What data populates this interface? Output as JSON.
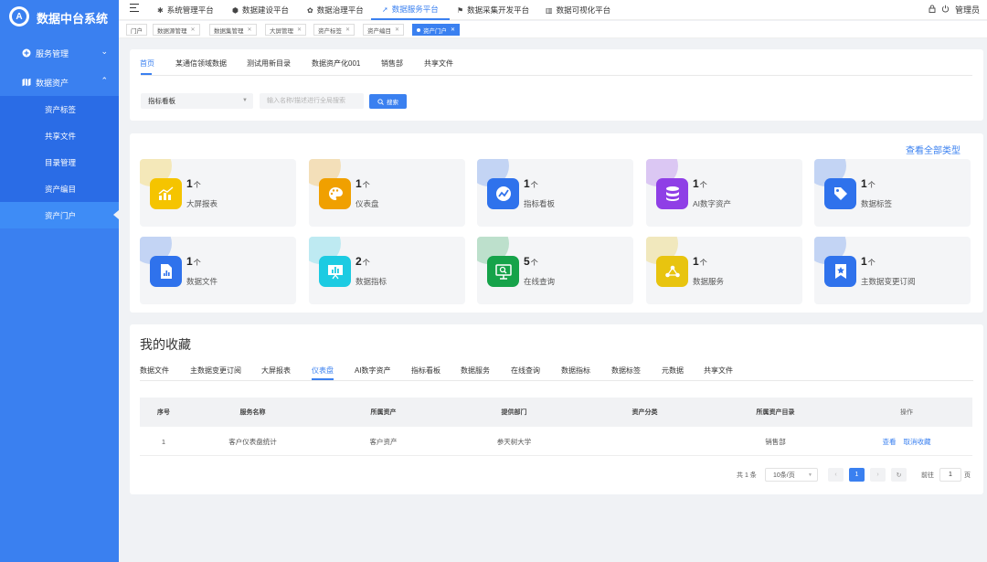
{
  "app": {
    "title": "数据中台系统",
    "logo_letter": "A"
  },
  "sidebar": {
    "groups": [
      {
        "label": "服务管理",
        "icon": "plus-circle-icon",
        "expanded": false
      },
      {
        "label": "数据资产",
        "icon": "map-icon",
        "expanded": true
      }
    ],
    "items": [
      {
        "label": "资产标签"
      },
      {
        "label": "共享文件"
      },
      {
        "label": "目录管理"
      },
      {
        "label": "资产编目"
      },
      {
        "label": "资产门户",
        "active": true
      }
    ]
  },
  "topbar": {
    "platforms": [
      {
        "label": "系统管理平台",
        "icon": "gear-icon"
      },
      {
        "label": "数据建设平台",
        "icon": "cube-icon"
      },
      {
        "label": "数据治理平台",
        "icon": "settings-icon"
      },
      {
        "label": "数据服务平台",
        "icon": "rocket-icon",
        "active": true
      },
      {
        "label": "数据采集开发平台",
        "icon": "flag-icon"
      },
      {
        "label": "数据可视化平台",
        "icon": "bar-chart-icon"
      }
    ],
    "user": "管理员"
  },
  "tags": [
    {
      "label": "门户",
      "closable": false
    },
    {
      "label": "数据源管理",
      "closable": true
    },
    {
      "label": "数据集管理",
      "closable": true
    },
    {
      "label": "大屏管理",
      "closable": true
    },
    {
      "label": "资产标签",
      "closable": true
    },
    {
      "label": "资产编目",
      "closable": true
    },
    {
      "label": "资产门户",
      "closable": true,
      "active": true
    }
  ],
  "portal": {
    "tabs": [
      "首页",
      "某通信领域数据",
      "测试用新目录",
      "数据资产化001",
      "销售部",
      "共享文件"
    ],
    "active_tab": 0,
    "search": {
      "select_value": "指标看板",
      "placeholder": "输入名称/描述进行全局搜索",
      "button": "搜索"
    }
  },
  "types": {
    "view_all": "查看全部类型",
    "unit": "个",
    "items": [
      {
        "count": "1",
        "label": "大屏报表",
        "color": "#f5c400",
        "icon": "chart-up-icon"
      },
      {
        "count": "1",
        "label": "仪表盘",
        "color": "#f0a000",
        "icon": "palette-icon"
      },
      {
        "count": "1",
        "label": "指标看板",
        "color": "#2f72ec",
        "icon": "pulse-icon"
      },
      {
        "count": "1",
        "label": "AI数字资产",
        "color": "#8f3fe6",
        "icon": "database-icon"
      },
      {
        "count": "1",
        "label": "数据标签",
        "color": "#2f72ec",
        "icon": "tag-icon"
      },
      {
        "count": "1",
        "label": "数据文件",
        "color": "#2f72ec",
        "icon": "file-chart-icon"
      },
      {
        "count": "2",
        "label": "数据指标",
        "color": "#1ccbe2",
        "icon": "presentation-icon"
      },
      {
        "count": "5",
        "label": "在线查询",
        "color": "#16a34a",
        "icon": "monitor-search-icon"
      },
      {
        "count": "1",
        "label": "数据服务",
        "color": "#e8c40f",
        "icon": "share-icon"
      },
      {
        "count": "1",
        "label": "主数据变更订阅",
        "color": "#2f72ec",
        "icon": "star-bookmark-icon"
      }
    ]
  },
  "favorites": {
    "title": "我的收藏",
    "tabs": [
      "数据文件",
      "主数据变更订阅",
      "大屏报表",
      "仪表盘",
      "AI数字资产",
      "指标看板",
      "数据服务",
      "在线查询",
      "数据指标",
      "数据标签",
      "元数据",
      "共享文件"
    ],
    "active_tab": 3,
    "columns": [
      "序号",
      "服务名称",
      "所属资产",
      "提供部门",
      "资产分类",
      "所属资产目录",
      "操作"
    ],
    "rows": [
      {
        "index": "1",
        "name": "客户仪表盘统计",
        "asset": "客户资产",
        "dept": "参天树大学",
        "category": "",
        "catalog": "销售部",
        "actions": [
          "查看",
          "取消收藏"
        ]
      }
    ],
    "pagination": {
      "total": "共 1 条",
      "page_size": "10条/页",
      "current": "1",
      "goto_label": "前往",
      "goto_value": "1",
      "page_suffix": "页"
    }
  }
}
